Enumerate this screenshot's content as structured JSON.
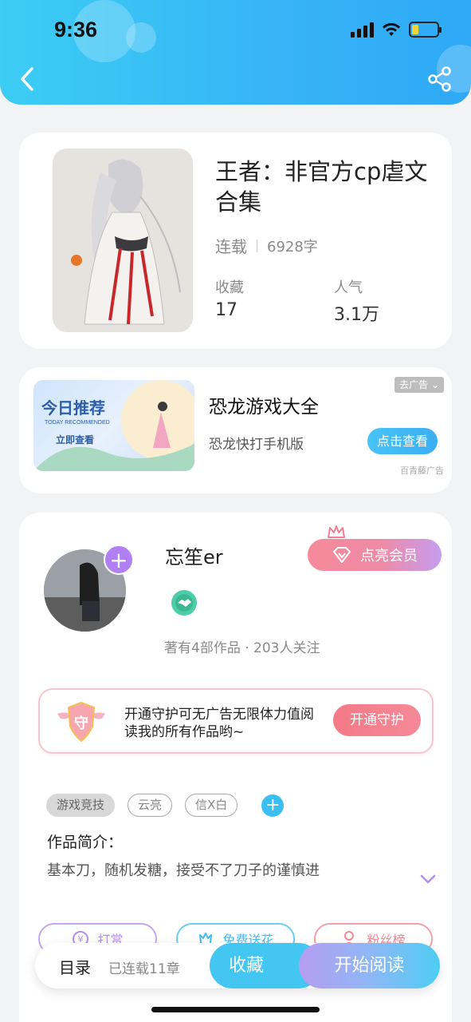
{
  "status_bar": {
    "time": "9:36"
  },
  "book": {
    "title": "王者：非官方cp虐文合集",
    "status": "连载",
    "word_count": "6928字",
    "favorites_label": "收藏",
    "favorites_value": "17",
    "popularity_label": "人气",
    "popularity_value": "3.1万"
  },
  "ad": {
    "image_title": "今日推荐",
    "image_subtitle": "TODAY RECOMMENDED",
    "image_button": "立即查看",
    "title": "恐龙游戏大全",
    "subtitle": "恐龙快打手机版",
    "cta": "点击查看",
    "remove_ad": "去广告",
    "source": "百青藤广告"
  },
  "author": {
    "name": "忘笙er",
    "vip_button": "点亮会员",
    "meta": "著有4部作品 · 203人关注",
    "guard_shield_text": "守",
    "guard_text": "开通守护可无广告无限体力值阅读我的所有作品哟~",
    "guard_button": "开通守护"
  },
  "tags": [
    "游戏竞技",
    "云亮",
    "信X白"
  ],
  "intro": {
    "label": "作品简介：",
    "text": "基本刀，随机发糖，接受不了刀子的谨慎进"
  },
  "actions": {
    "tip": "打赏",
    "flower": "免费送花",
    "fans": "粉丝榜"
  },
  "bottom_bar": {
    "toc": "目录",
    "chapters": "已连载11章",
    "favorite": "收藏",
    "read": "开始阅读"
  },
  "colors": {
    "header_gradient_start": "#3ccdf3",
    "header_gradient_end": "#2ea9f6",
    "accent_blue": "#43c6f2",
    "vip_pink": "#f58a9a",
    "purple": "#b07ff3"
  }
}
